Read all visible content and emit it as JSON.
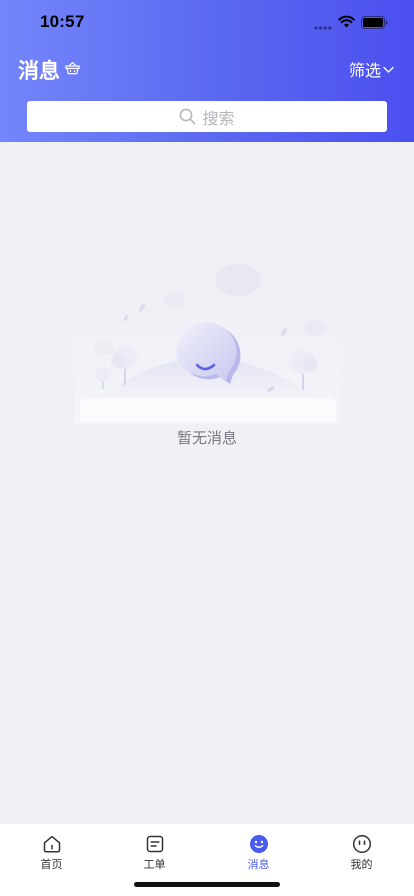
{
  "status_bar": {
    "time": "10:57"
  },
  "header": {
    "title": "消息",
    "filter_label": "筛选",
    "search_placeholder": "搜索",
    "accent": "#5a67f0"
  },
  "empty": {
    "message": "暂无消息"
  },
  "tabbar": {
    "active_color": "#4a5cf0",
    "items": [
      {
        "label": "首页",
        "icon": "home-icon"
      },
      {
        "label": "工单",
        "icon": "work-order-icon"
      },
      {
        "label": "消息",
        "icon": "message-smile-icon",
        "active": true
      },
      {
        "label": "我的",
        "icon": "profile-face-icon"
      }
    ]
  }
}
